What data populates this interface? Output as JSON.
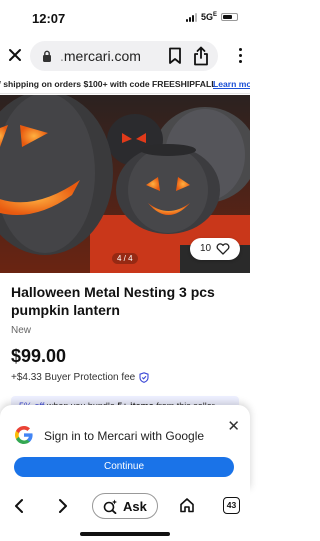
{
  "status_bar": {
    "time": "12:07",
    "network": "5G",
    "network_suffix": "E"
  },
  "browser": {
    "url_dim": ".",
    "url_host": "mercari.com",
    "icons": [
      "close-icon",
      "lock-icon",
      "bookmark-icon",
      "share-icon",
      "more-icon"
    ]
  },
  "promo": {
    "text": "f shipping on orders $100+ with code FREESHIPFALL",
    "link": "Learn mo"
  },
  "gallery": {
    "page_indicator": "4 / 4",
    "like_count": "10"
  },
  "item": {
    "title": "Halloween Metal Nesting 3 pcs pumpkin lantern",
    "condition": "New",
    "price": "$99.00",
    "fee": "+$4.33 Buyer Protection fee"
  },
  "bundle": {
    "percent": "5% off",
    "text_1": " when you bundle ",
    "count": "5+ items",
    "text_2": " from this seller"
  },
  "signin_sheet": {
    "title": "Sign in to Mercari with Google",
    "button": "Continue"
  },
  "bottom_nav": {
    "ask_label": "Ask",
    "tab_count": "43"
  },
  "colors": {
    "link": "#1a4fd6",
    "continue_button": "#1a73e8",
    "bundle_bg": "#eef0ff",
    "bundle_accent": "#3d49d6",
    "pumpkin_glow": "#f06a1c"
  }
}
